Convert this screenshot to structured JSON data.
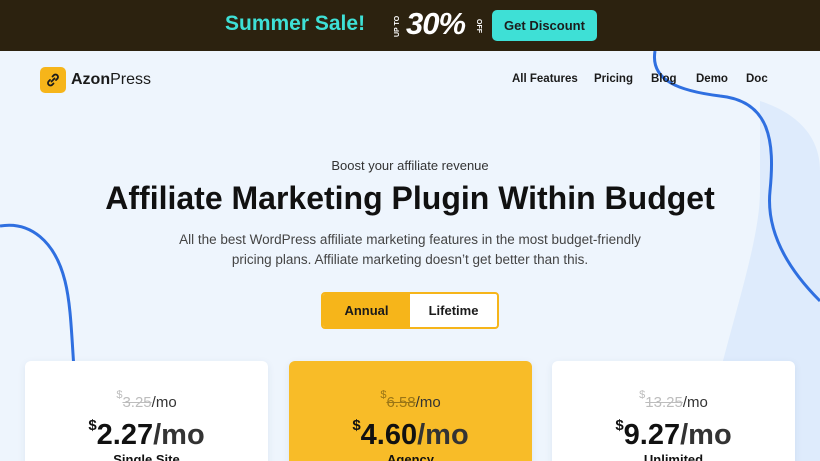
{
  "banner": {
    "sale_text": "Summer Sale!",
    "upto_text": "UP TO",
    "discount_text": "30%",
    "off_text": "OFF",
    "cta_label": "Get Discount"
  },
  "brand": {
    "name_bold": "Azon",
    "name_rest": "Press"
  },
  "nav": {
    "items": [
      {
        "label": "All Features"
      },
      {
        "label": "Pricing"
      },
      {
        "label": "Blog"
      },
      {
        "label": "Demo"
      },
      {
        "label": "Doc"
      }
    ]
  },
  "hero": {
    "eyebrow": "Boost your affiliate revenue",
    "title": "Affiliate Marketing Plugin Within Budget",
    "desc_line1": "All the best WordPress affiliate marketing features in the most budget-friendly",
    "desc_line2": "pricing plans. Affiliate marketing doesn’t get better than this."
  },
  "billing_toggle": {
    "options": [
      {
        "label": "Annual",
        "active": true
      },
      {
        "label": "Lifetime",
        "active": false
      }
    ]
  },
  "plans": [
    {
      "currency": "$",
      "old_price": "3.25",
      "price": "2.27",
      "period": "/mo",
      "name": "Single Site",
      "featured": false
    },
    {
      "currency": "$",
      "old_price": "6.58",
      "price": "4.60",
      "period": "/mo",
      "name": "Agency",
      "featured": true
    },
    {
      "currency": "$",
      "old_price": "13.25",
      "price": "9.27",
      "period": "/mo",
      "name": "Unlimited",
      "featured": false
    }
  ],
  "colors": {
    "banner_bg": "#2c220f",
    "banner_accent": "#3ee0d6",
    "brand_yellow": "#f6b51a",
    "page_bg": "#eef5fd",
    "decor_line": "#2f6fe0"
  }
}
